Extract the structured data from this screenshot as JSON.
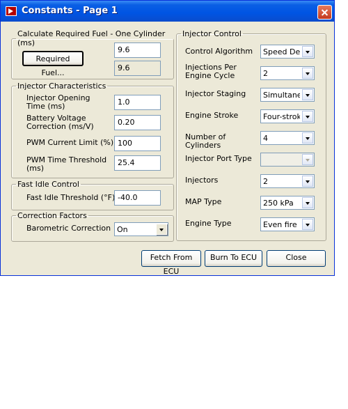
{
  "window": {
    "title": "Constants - Page 1"
  },
  "required_fuel": {
    "legend": "Calculate Required Fuel - One Cylinder (ms)",
    "button_label": "Required Fuel...",
    "value": "9.6",
    "readonly_value": "9.6"
  },
  "injector_characteristics": {
    "legend": "Injector Characteristics",
    "opening_time_label": "Injector Opening Time (ms)",
    "opening_time_value": "1.0",
    "battery_correction_label": "Battery Voltage Correction (ms/V)",
    "battery_correction_value": "0.20",
    "pwm_current_label": "PWM Current Limit (%)",
    "pwm_current_value": "100",
    "pwm_threshold_label": "PWM Time Threshold (ms)",
    "pwm_threshold_value": "25.4"
  },
  "fast_idle": {
    "legend": "Fast Idle Control",
    "threshold_label": "Fast Idle Threshold (°F)",
    "threshold_value": "-40.0"
  },
  "correction_factors": {
    "legend": "Correction Factors",
    "barometric_label": "Barometric Correction",
    "barometric_value": "On"
  },
  "injector_control": {
    "legend": "Injector Control",
    "control_algorithm_label": "Control Algorithm",
    "control_algorithm_value": "Speed Density",
    "injections_per_cycle_label": "Injections Per Engine Cycle",
    "injections_per_cycle_value": "2",
    "injector_staging_label": "Injector Staging",
    "injector_staging_value": "Simultaneous",
    "engine_stroke_label": "Engine Stroke",
    "engine_stroke_value": "Four-stroke",
    "num_cylinders_label": "Number of Cylinders",
    "num_cylinders_value": "4",
    "injector_port_type_label": "Injector Port Type",
    "injector_port_type_value": "",
    "injectors_label": "Injectors",
    "injectors_value": "2",
    "map_type_label": "MAP Type",
    "map_type_value": "250 kPa",
    "engine_type_label": "Engine Type",
    "engine_type_value": "Even fire"
  },
  "buttons": {
    "fetch": "Fetch From ECU",
    "burn": "Burn To ECU",
    "close": "Close"
  }
}
